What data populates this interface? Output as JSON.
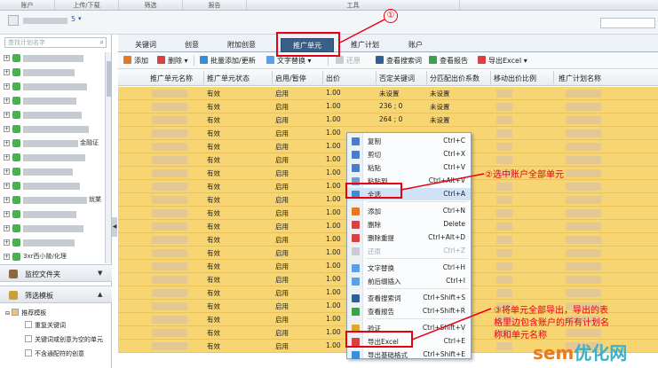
{
  "menubar": [
    "账户",
    "上传/下载",
    "筛选",
    "报告",
    "工具"
  ],
  "account": {
    "count": "5"
  },
  "left": {
    "search_placeholder": "查找计划名字",
    "tree_suffixes": [
      "金融证",
      "就業"
    ],
    "tree_last": "3xr西小陵/化理",
    "monitor_folder": "监控文件夹",
    "filter_template": "筛选模板",
    "recommend_template": "推荐模板",
    "template_items": [
      "重复关键词",
      "关键词或创意为空的单元",
      "不含通配符的创意"
    ]
  },
  "tabs": [
    "关键词",
    "创意",
    "附加创意",
    "推广单元",
    "推广计划",
    "账户"
  ],
  "toolbar": {
    "add": "添加",
    "delete": "删除",
    "batch": "批量添加/更新",
    "replace": "文字替换",
    "restore": "还原",
    "search_words": "查看搜索词",
    "report": "查看报告",
    "export": "导出Excel"
  },
  "grid": {
    "headers": [
      "推广单元名称",
      "推广单元状态",
      "启用/暂停",
      "出价",
      "否定关键词",
      "分匹配出价系数",
      "移动出价比例",
      "推广计划名称"
    ],
    "rows": [
      [
        "有效",
        "启用",
        "1.00",
        "未设置",
        "未设置"
      ],
      [
        "有效",
        "启用",
        "1.00",
        "236 ; 0",
        "未设置"
      ],
      [
        "有效",
        "启用",
        "1.00",
        "264 ; 0",
        "未设置"
      ],
      [
        "有效",
        "启用",
        "1.00",
        "",
        ""
      ],
      [
        "有效",
        "启用",
        "1.00",
        "",
        ""
      ],
      [
        "有效",
        "启用",
        "1.00",
        "",
        ""
      ],
      [
        "有效",
        "启用",
        "1.00",
        "",
        ""
      ],
      [
        "有效",
        "启用",
        "1.00",
        "",
        ""
      ],
      [
        "有效",
        "启用",
        "1.00",
        "",
        ""
      ],
      [
        "有效",
        "启用",
        "1.00",
        "",
        ""
      ],
      [
        "有效",
        "启用",
        "1.00",
        "",
        ""
      ],
      [
        "有效",
        "启用",
        "1.00",
        "",
        ""
      ],
      [
        "有效",
        "启用",
        "1.00",
        "",
        ""
      ],
      [
        "有效",
        "启用",
        "1.00",
        "",
        ""
      ],
      [
        "有效",
        "启用",
        "1.00",
        "",
        ""
      ],
      [
        "有效",
        "启用",
        "1.00",
        "",
        ""
      ],
      [
        "有效",
        "启用",
        "1.00",
        "",
        ""
      ],
      [
        "有效",
        "启用",
        "1.00",
        "",
        ""
      ],
      [
        "有效",
        "启用",
        "1.00",
        "",
        ""
      ],
      [
        "有效",
        "启用",
        "1.00",
        "",
        ""
      ]
    ]
  },
  "context_menu": [
    {
      "label": "复制",
      "shortcut": "Ctrl+C"
    },
    {
      "label": "剪切",
      "shortcut": "Ctrl+X"
    },
    {
      "label": "粘贴",
      "shortcut": "Ctrl+V"
    },
    {
      "label": "粘贴到...",
      "shortcut": "Ctrl+Alt+V"
    },
    {
      "label": "全选",
      "shortcut": "Ctrl+A"
    },
    {
      "label": "添加",
      "shortcut": "Ctrl+N"
    },
    {
      "label": "删除",
      "shortcut": "Delete"
    },
    {
      "label": "删除重提",
      "shortcut": "Ctrl+Alt+D"
    },
    {
      "label": "还原",
      "shortcut": "Ctrl+Z"
    },
    {
      "label": "文字替换",
      "shortcut": "Ctrl+H"
    },
    {
      "label": "前后缀插入",
      "shortcut": "Ctrl+I"
    },
    {
      "label": "查看搜索词",
      "shortcut": "Ctrl+Shift+S"
    },
    {
      "label": "查看报告",
      "shortcut": "Ctrl+Shift+R"
    },
    {
      "label": "验证",
      "shortcut": "Ctrl+Shift+V"
    },
    {
      "label": "导出Excel",
      "shortcut": "Ctrl+E"
    },
    {
      "label": "导出基础格式",
      "shortcut": "Ctrl+Shift+E"
    }
  ],
  "annotations": {
    "step1": "①",
    "step2": "②选中账户全部单元",
    "step3_line1": "③将单元全部导出，导出的表",
    "step3_line2": "格里边包含账户的所有计划名",
    "step3_line3": "称和单元名称"
  },
  "watermark": {
    "part1": "sem",
    "part2": "优化网"
  },
  "colors": {
    "row_highlight": "#f7d572",
    "annotation_red": "#e60012",
    "active_tab": "#3a5f86"
  }
}
